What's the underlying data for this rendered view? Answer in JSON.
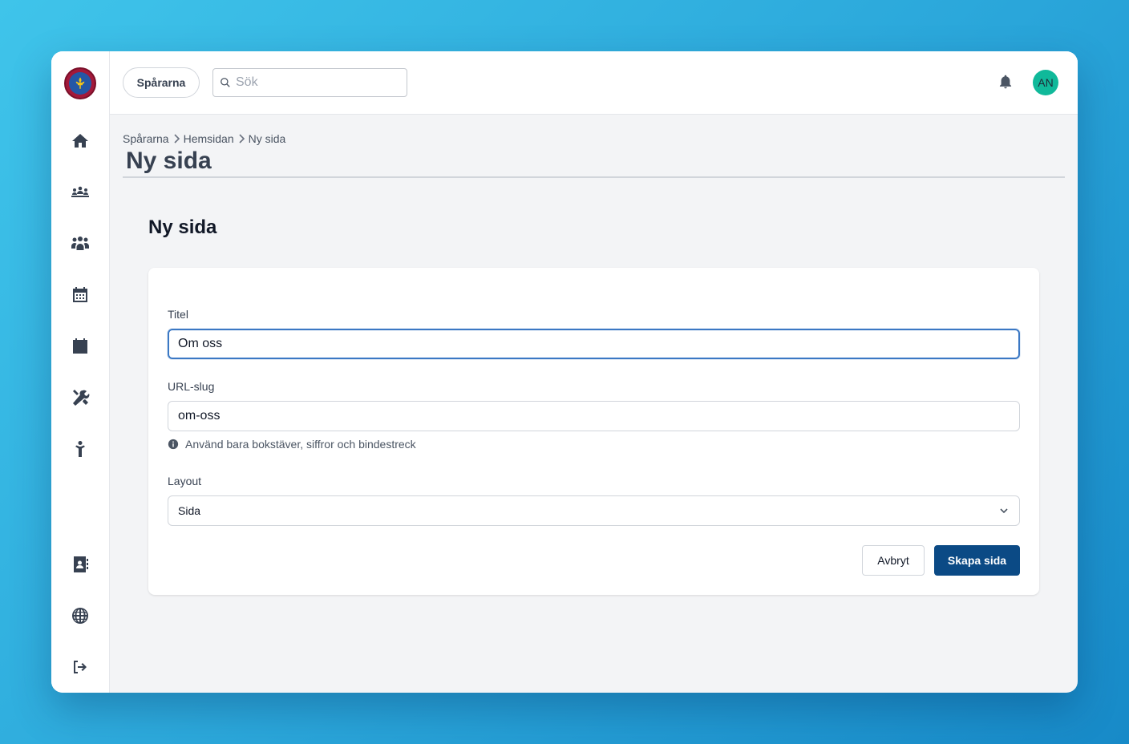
{
  "header": {
    "org_button_label": "Spårarna",
    "search_placeholder": "Sök",
    "avatar_initials": "AN"
  },
  "sidebar": {
    "items": [
      {
        "icon": "home-icon"
      },
      {
        "icon": "group-meeting-icon"
      },
      {
        "icon": "users-icon"
      },
      {
        "icon": "calendar-grid-icon"
      },
      {
        "icon": "calendar-icon"
      },
      {
        "icon": "tools-icon"
      },
      {
        "icon": "child-icon"
      },
      {
        "icon": "address-book-icon"
      },
      {
        "icon": "globe-icon"
      },
      {
        "icon": "sign-out-icon"
      }
    ]
  },
  "breadcrumb": [
    "Spårarna",
    "Hemsidan",
    "Ny sida"
  ],
  "page": {
    "title": "Ny sida",
    "section_heading": "Ny sida"
  },
  "form": {
    "title_label": "Titel",
    "title_value": "Om oss",
    "slug_label": "URL-slug",
    "slug_value": "om-oss",
    "slug_hint": "Använd bara bokstäver, siffror och bindestreck",
    "layout_label": "Layout",
    "layout_value": "Sida",
    "cancel_label": "Avbryt",
    "submit_label": "Skapa sida"
  },
  "colors": {
    "primary": "#0b4a85",
    "avatar": "#10b99a",
    "focus": "#3b78c4"
  }
}
